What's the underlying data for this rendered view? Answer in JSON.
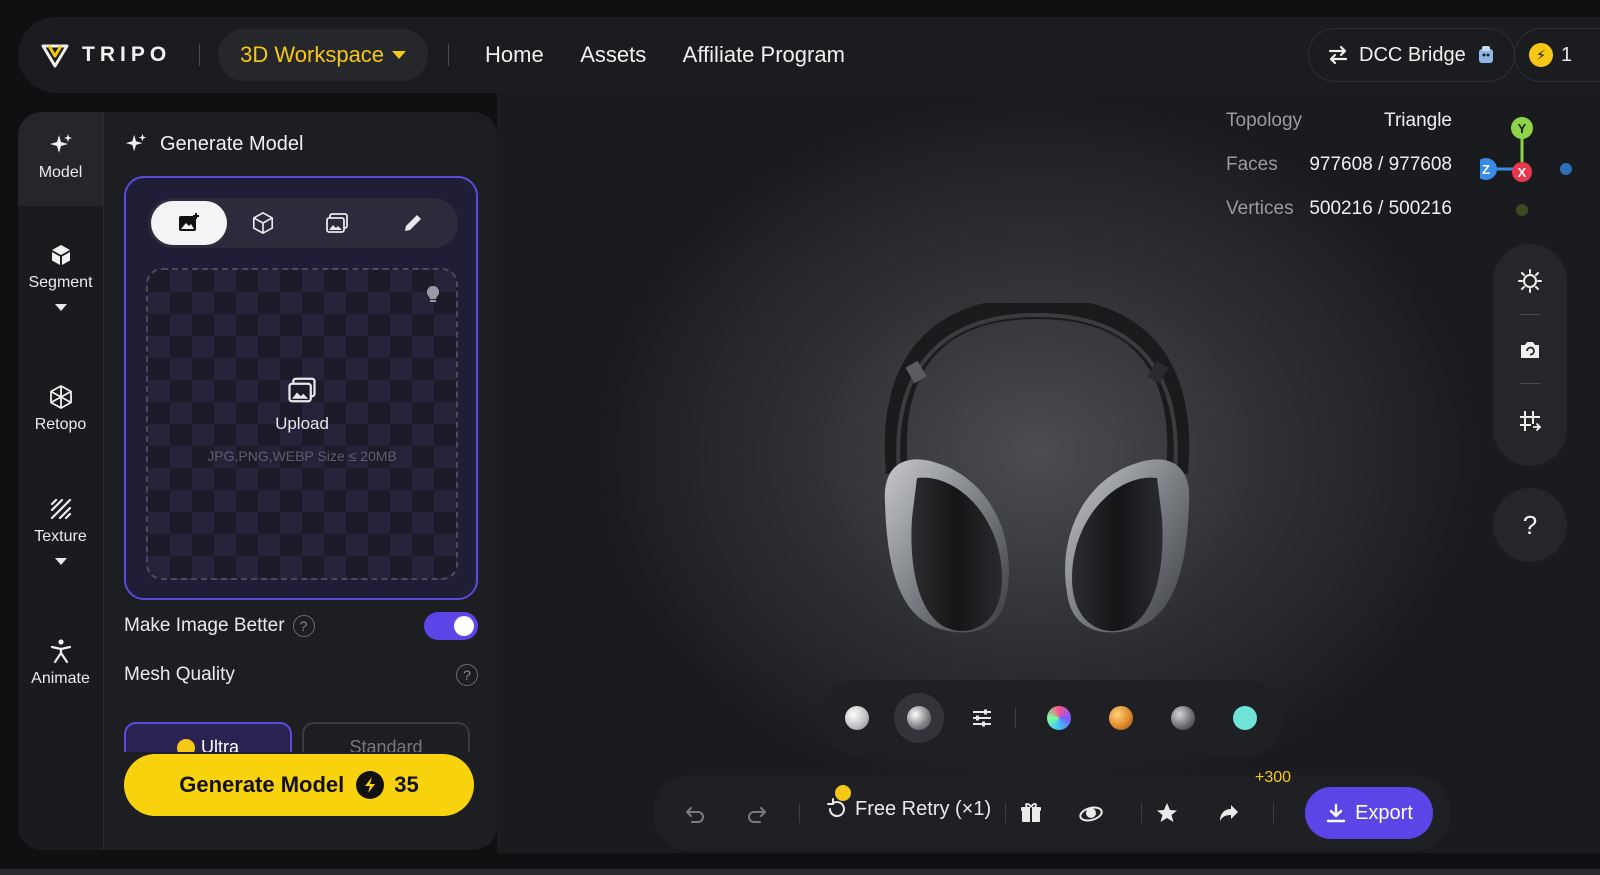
{
  "topbar": {
    "logo_text": "TRIPO",
    "workspace_label": "3D Workspace",
    "nav": [
      "Home",
      "Assets",
      "Affiliate Program"
    ],
    "dcc_label": "DCC Bridge",
    "credits_value": "1"
  },
  "sidebar": {
    "items": [
      {
        "label": "Model",
        "icon": "sparkle-icon",
        "active": true
      },
      {
        "label": "Segment",
        "icon": "cube-icon"
      },
      {
        "label": "Retopo",
        "icon": "wireframe-icon"
      },
      {
        "label": "Texture",
        "icon": "texture-icon"
      },
      {
        "label": "Animate",
        "icon": "figure-icon"
      }
    ]
  },
  "panel": {
    "title": "Generate Model",
    "mode_tabs": [
      "image-plus-icon",
      "cube-icon",
      "multi-image-icon",
      "pencil-icon"
    ],
    "upload_label": "Upload",
    "upload_hint": "JPG,PNG,WEBP Size ≤ 20MB",
    "make_better_label": "Make Image Better",
    "make_better_on": true,
    "mesh_quality_label": "Mesh Quality",
    "quality_ultra": "Ultra",
    "quality_standard": "Standard",
    "generate_label": "Generate Model",
    "generate_cost": "35"
  },
  "stats": {
    "topology_label": "Topology",
    "topology_value": "Triangle",
    "faces_label": "Faces",
    "faces_value": "977608 / 977608",
    "vertices_label": "Vertices",
    "vertices_value": "500216 / 500216"
  },
  "axes": {
    "y": "Y",
    "z": "Z",
    "x": "X"
  },
  "colors": {
    "accent": "#5b45e6",
    "brand": "#f7d20d"
  },
  "help_label": "?",
  "actions": {
    "retry_label": "Free Retry (×1)",
    "bonus": "+300",
    "export_label": "Export"
  }
}
